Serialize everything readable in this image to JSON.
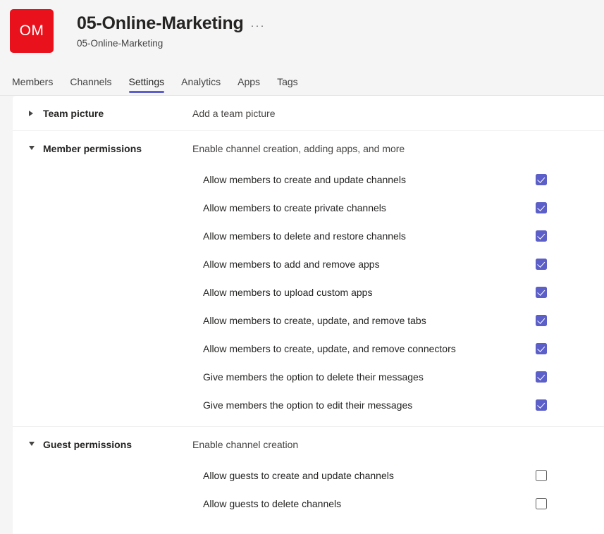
{
  "header": {
    "avatar_initials": "OM",
    "avatar_color": "#e8111c",
    "title": "05-Online-Marketing",
    "subtitle": "05-Online-Marketing",
    "more_options_label": "···"
  },
  "tabs": [
    {
      "label": "Members",
      "active": false
    },
    {
      "label": "Channels",
      "active": false
    },
    {
      "label": "Settings",
      "active": true
    },
    {
      "label": "Analytics",
      "active": false
    },
    {
      "label": "Apps",
      "active": false
    },
    {
      "label": "Tags",
      "active": false
    }
  ],
  "accent_color": "#5b5fc7",
  "sections": [
    {
      "title": "Team picture",
      "description": "Add a team picture",
      "expanded": false,
      "settings": []
    },
    {
      "title": "Member permissions",
      "description": "Enable channel creation, adding apps, and more",
      "expanded": true,
      "settings": [
        {
          "label": "Allow members to create and update channels",
          "checked": true
        },
        {
          "label": "Allow members to create private channels",
          "checked": true
        },
        {
          "label": "Allow members to delete and restore channels",
          "checked": true
        },
        {
          "label": "Allow members to add and remove apps",
          "checked": true
        },
        {
          "label": "Allow members to upload custom apps",
          "checked": true
        },
        {
          "label": "Allow members to create, update, and remove tabs",
          "checked": true
        },
        {
          "label": "Allow members to create, update, and remove connectors",
          "checked": true
        },
        {
          "label": "Give members the option to delete their messages",
          "checked": true
        },
        {
          "label": "Give members the option to edit their messages",
          "checked": true
        }
      ]
    },
    {
      "title": "Guest permissions",
      "description": "Enable channel creation",
      "expanded": true,
      "settings": [
        {
          "label": "Allow guests to create and update channels",
          "checked": false
        },
        {
          "label": "Allow guests to delete channels",
          "checked": false
        }
      ]
    }
  ]
}
